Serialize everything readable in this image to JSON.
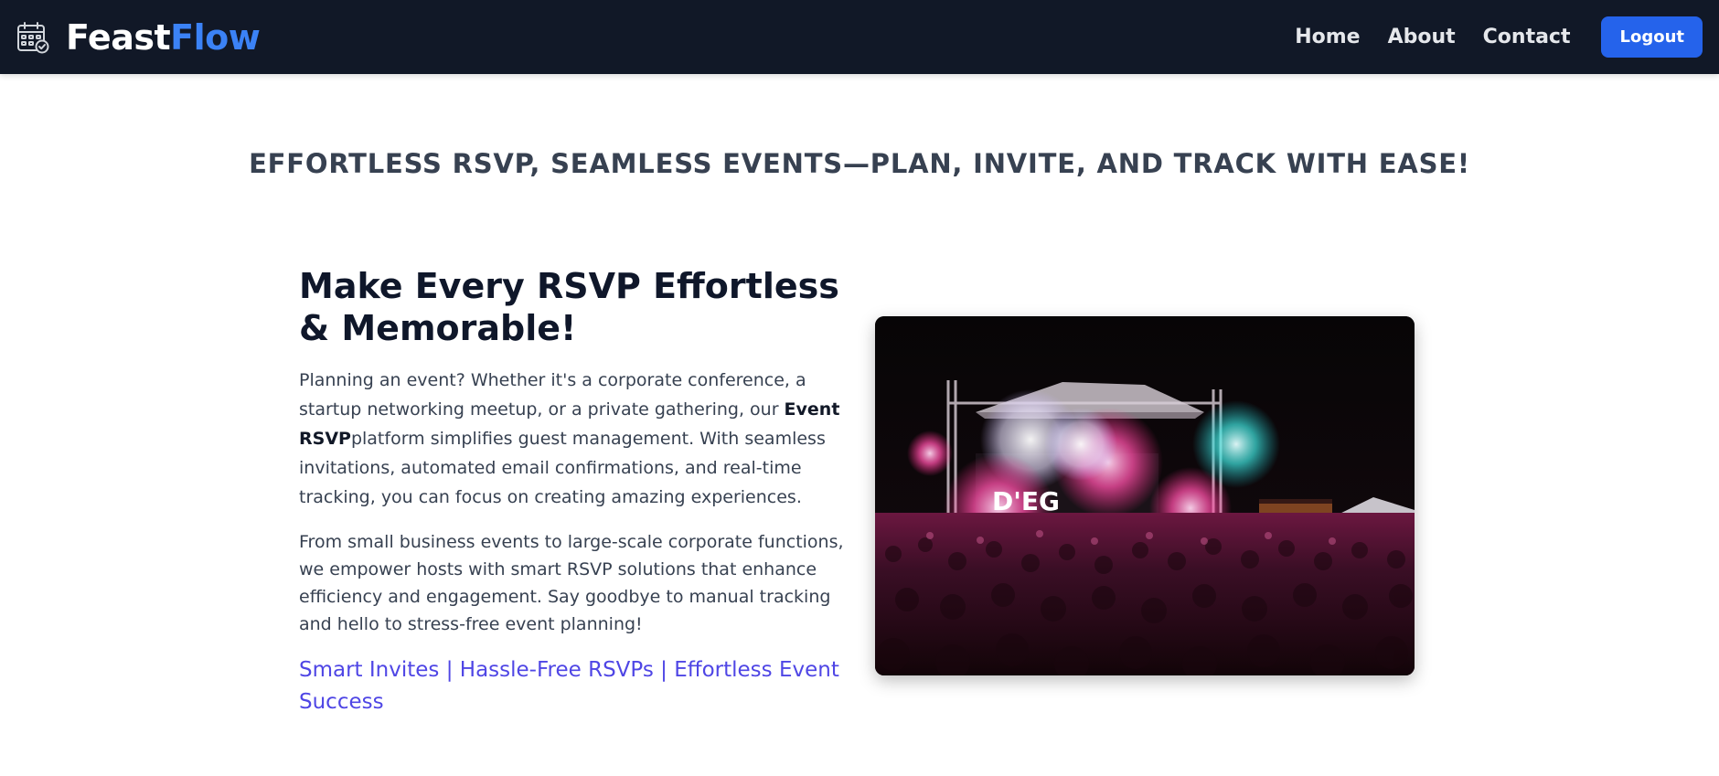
{
  "header": {
    "brand": {
      "name_part1": "Feast",
      "name_part2": "Flow",
      "icon": "calendar-check-icon"
    },
    "nav": {
      "home": "Home",
      "about": "About",
      "contact": "Contact",
      "logout": "Logout"
    }
  },
  "tagline": "EFFORTLESS RSVP, SEAMLESS EVENTS—PLAN, INVITE, AND TRACK WITH EASE!",
  "main": {
    "headline": "Make Every RSVP Effortless & Memorable!",
    "paragraph1": {
      "before": "Planning an event? Whether it's a corporate conference, a startup networking meetup, or a private gathering, our ",
      "bold": "Event RSVP",
      "after": "platform simplifies guest management. With seamless invitations, automated email confirmations, and real-time tracking, you can focus on creating amazing experiences."
    },
    "paragraph2": "From small business events to large-scale corporate functions, we empower hosts with smart RSVP solutions that enhance efficiency and engagement. Say goodbye to manual tracking and hello to stress-free event planning!",
    "highlights": "Smart Invites | Hassle-Free RSVPs | Effortless Event Success"
  },
  "hero_image": {
    "description": "concert-crowd-photo",
    "stage_sign": "D'EG"
  },
  "colors": {
    "navbar_bg": "#111827",
    "brand_accent": "#3B82F6",
    "button_bg": "#2563EB",
    "highlight_text": "#4F46E5",
    "heading_text": "#0F172A"
  }
}
